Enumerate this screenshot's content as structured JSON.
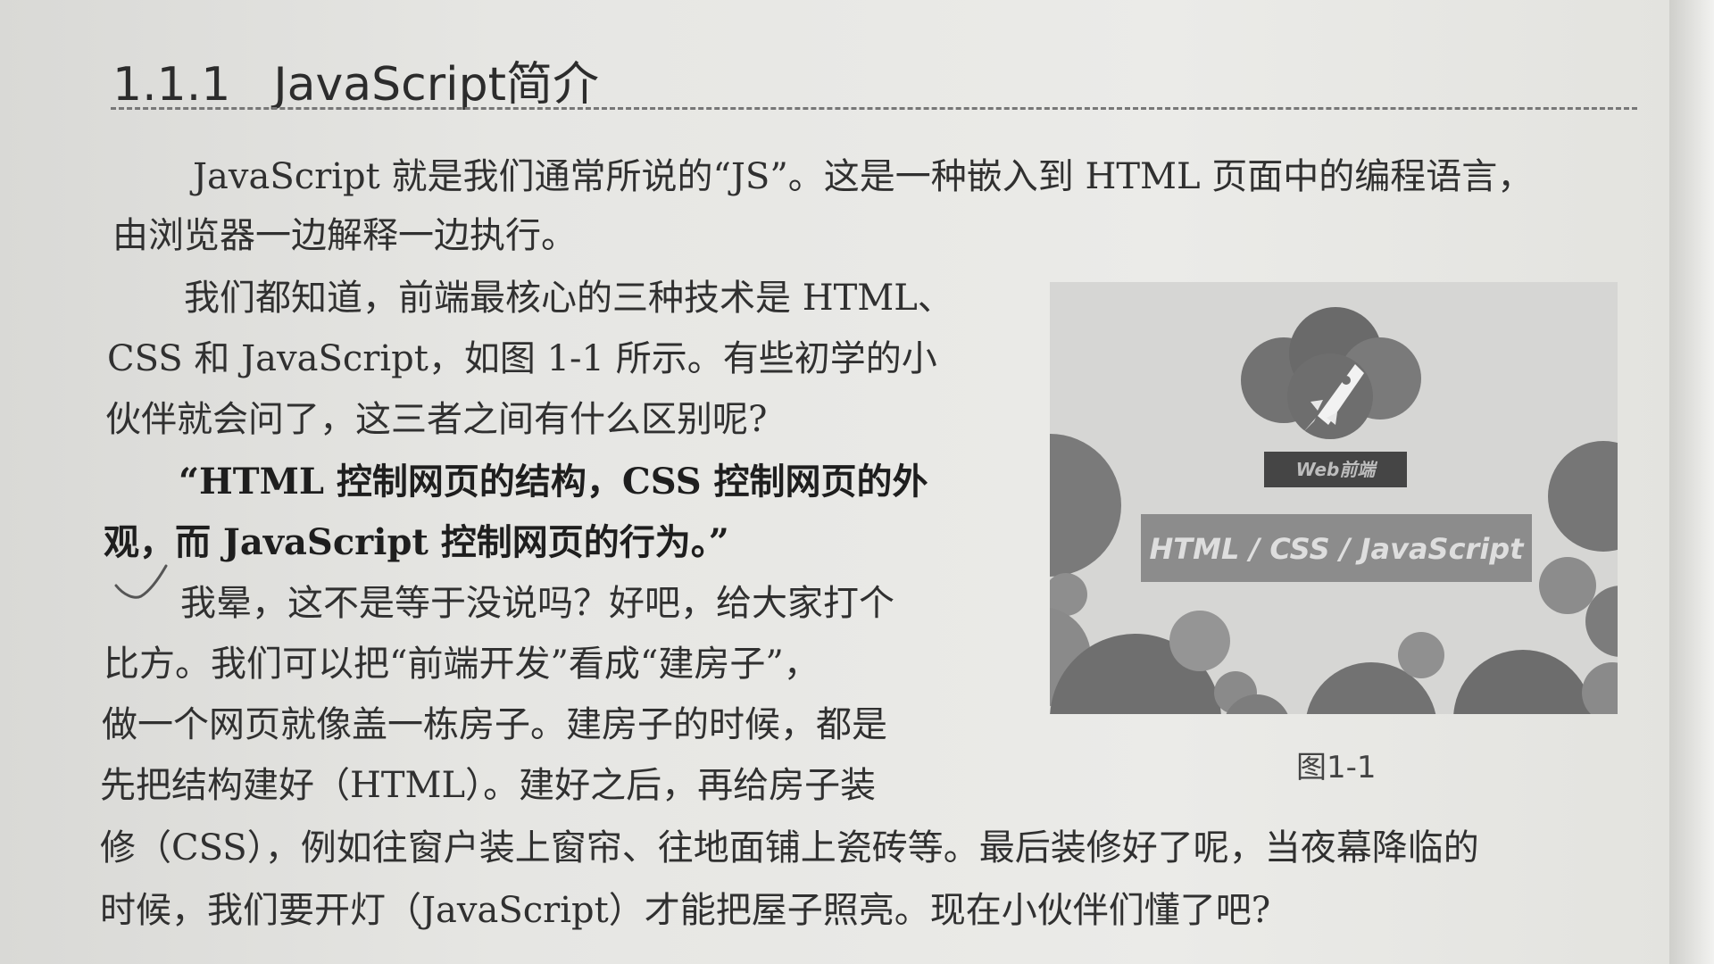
{
  "section": {
    "number": "1.1.1",
    "title": "JavaScript简介"
  },
  "paragraphs": {
    "p1_l1": "JavaScript 就是我们通常所说的“JS”。这是一种嵌入到 HTML 页面中的编程语言，",
    "p1_l2": "由浏览器一边解释一边执行。",
    "p2_l1": "我们都知道，前端最核心的三种技术是 HTML、",
    "p2_l2": "CSS 和 JavaScript，如图 1-1 所示。有些初学的小",
    "p2_l3": "伙伴就会问了，这三者之间有什么区别呢?",
    "p3_l1": "“HTML 控制网页的结构，CSS 控制网页的外",
    "p3_l2": "观，而 JavaScript 控制网页的行为。”",
    "p4_l1": "我晕，这不是等于没说吗？好吧，给大家打个",
    "p4_l2": "比方。我们可以把“前端开发”看成“建房子”，",
    "p4_l3": "做一个网页就像盖一栋房子。建房子的时候，都是",
    "p4_l4": "先把结构建好（HTML）。建好之后，再给房子装",
    "p4_l5": "修（CSS），例如往窗户装上窗帘、往地面铺上瓷砖等。最后装修好了呢，当夜幕降临的",
    "p4_l6": "时候，我们要开灯（JavaScript）才能把屋子照亮。现在小伙伴们懂了吧?"
  },
  "figure": {
    "badge_label": "Web前端",
    "banner_text": "HTML / CSS / JavaScript",
    "caption": "图1-1",
    "icon": "rocket-icon"
  },
  "colors": {
    "figure_dark": "#707070",
    "figure_mid": "#8a8a8a",
    "badge_bg": "#444444"
  }
}
